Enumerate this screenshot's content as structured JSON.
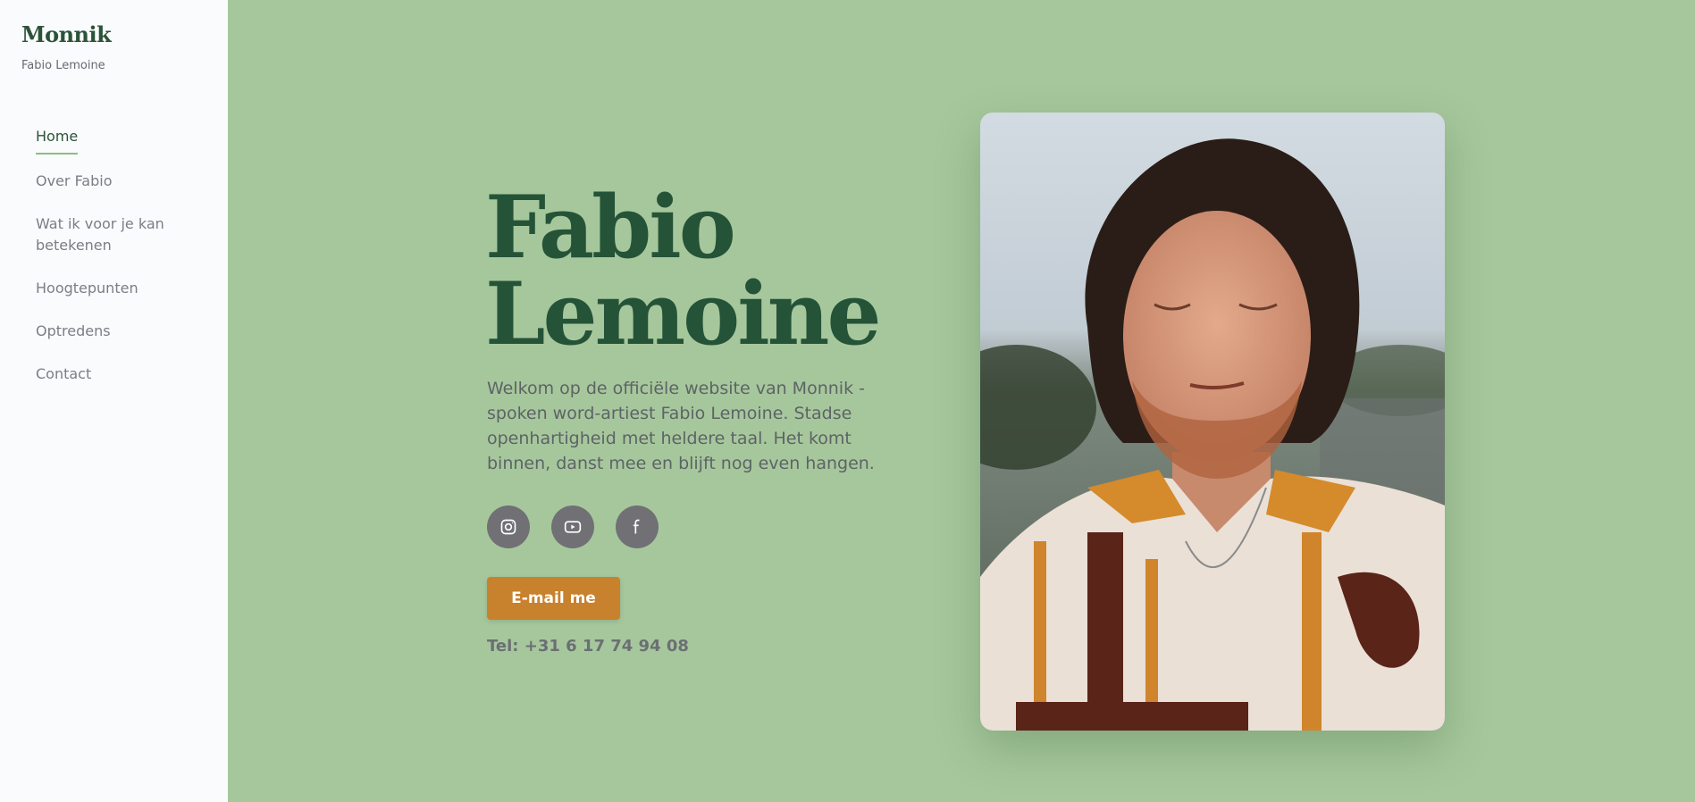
{
  "sidebar": {
    "brand": "Monnik",
    "subtitle": "Fabio Lemoine",
    "nav": [
      {
        "label": "Home",
        "active": true
      },
      {
        "label": "Over Fabio"
      },
      {
        "label": "Wat ik voor je kan betekenen"
      },
      {
        "label": "Hoogtepunten"
      },
      {
        "label": "Optredens"
      },
      {
        "label": "Contact"
      }
    ]
  },
  "hero": {
    "title_line1": "Fabio",
    "title_line2": "Lemoine",
    "description": "Welkom op de officiële website van Monnik - spoken word-artiest Fabio Lemoine. Stadse openhartigheid met heldere taal. Het komt binnen, danst mee en blijft nog even hangen.",
    "socials": [
      {
        "icon": "instagram-icon"
      },
      {
        "icon": "youtube-icon"
      },
      {
        "icon": "facebook-icon"
      }
    ],
    "email_button": "E-mail me",
    "tel": "Tel: +31 6 17 74 94 08"
  },
  "colors": {
    "background": "#a6c79c",
    "sidebar": "#fafbfd",
    "title": "#255338",
    "accent_button": "#c8812d",
    "social_bg": "#707075"
  }
}
